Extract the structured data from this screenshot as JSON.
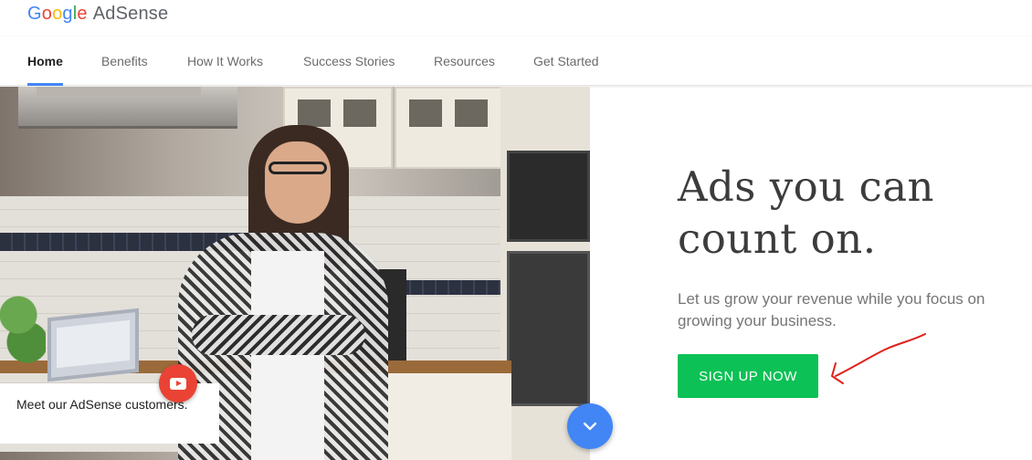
{
  "header": {
    "logo_google": [
      "G",
      "o",
      "o",
      "g",
      "l",
      "e"
    ],
    "logo_product": "AdSense"
  },
  "nav": {
    "tabs": [
      {
        "label": "Home",
        "active": true
      },
      {
        "label": "Benefits",
        "active": false
      },
      {
        "label": "How It Works",
        "active": false
      },
      {
        "label": "Success Stories",
        "active": false
      },
      {
        "label": "Resources",
        "active": false
      },
      {
        "label": "Get Started",
        "active": false
      }
    ]
  },
  "hero": {
    "caption": "Meet our AdSense customers.",
    "play_icon": "youtube-play-icon",
    "scroll_icon": "chevron-down-icon"
  },
  "content": {
    "headline_line1": "Ads you can",
    "headline_line2": "count on.",
    "subtext": "Let us grow your revenue while you focus on growing your business.",
    "cta_label": "SIGN UP NOW"
  },
  "colors": {
    "google_blue": "#4285f4",
    "google_red": "#ea4335",
    "google_yellow": "#fbbc05",
    "google_green": "#34a853",
    "cta_green": "#0cc155",
    "annotation_red": "#e0201b"
  }
}
